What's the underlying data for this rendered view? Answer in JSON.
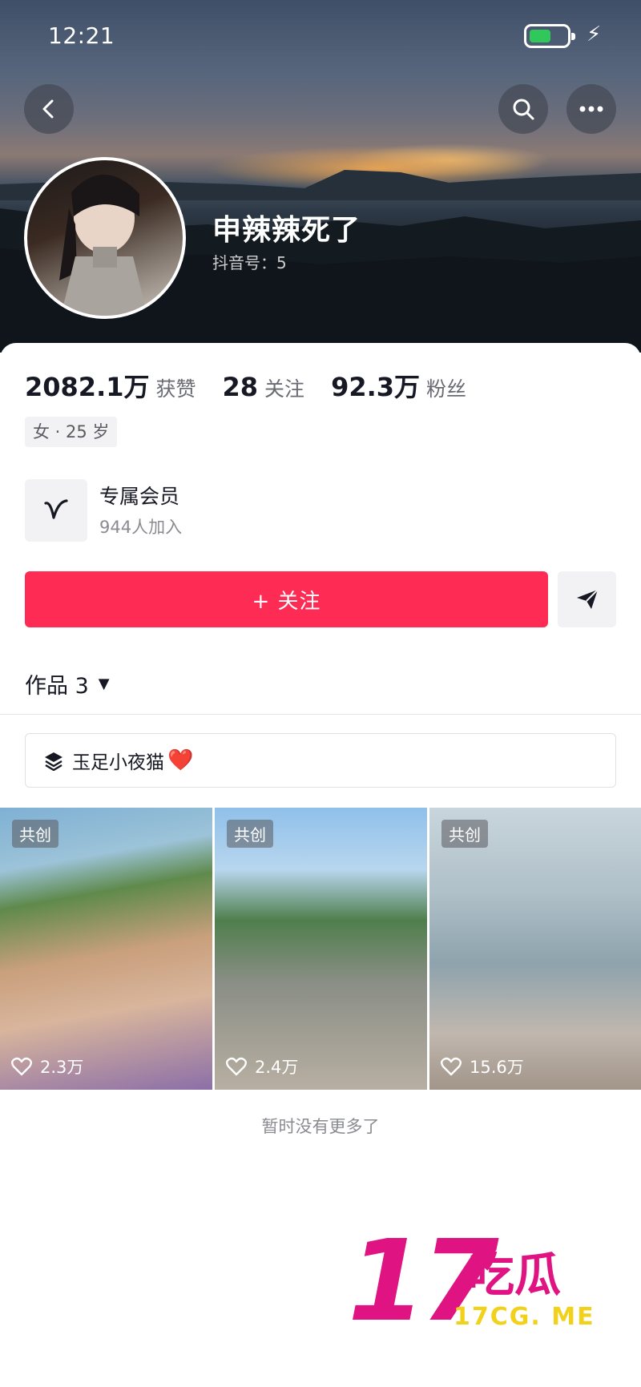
{
  "status_bar": {
    "time": "12:21"
  },
  "profile": {
    "nickname": "申辣辣死了",
    "douyin_id": "抖音号：5"
  },
  "stats": [
    {
      "value": "2082.1万",
      "label": "获赞"
    },
    {
      "value": "28",
      "label": "关注"
    },
    {
      "value": "92.3万",
      "label": "粉丝"
    }
  ],
  "tag": "女 · 25 岁",
  "membership": {
    "title": "专属会员",
    "subtitle": "944人加入"
  },
  "actions": {
    "follow_label": "+ 关注"
  },
  "works_tab": {
    "label": "作品 3"
  },
  "collection": {
    "label": "玉足小夜猫",
    "emoji": "❤️"
  },
  "videos": [
    {
      "badge": "共创",
      "likes": "2.3万"
    },
    {
      "badge": "共创",
      "likes": "2.4万"
    },
    {
      "badge": "共创",
      "likes": "15.6万"
    }
  ],
  "footer_text": "暂时没有更多了",
  "watermark": {
    "number": "17",
    "chinese": "吃瓜",
    "url": "17CG. ME"
  },
  "colors": {
    "accent": "#fe2c55",
    "battery": "#30c85a",
    "watermark": "#e01383"
  }
}
